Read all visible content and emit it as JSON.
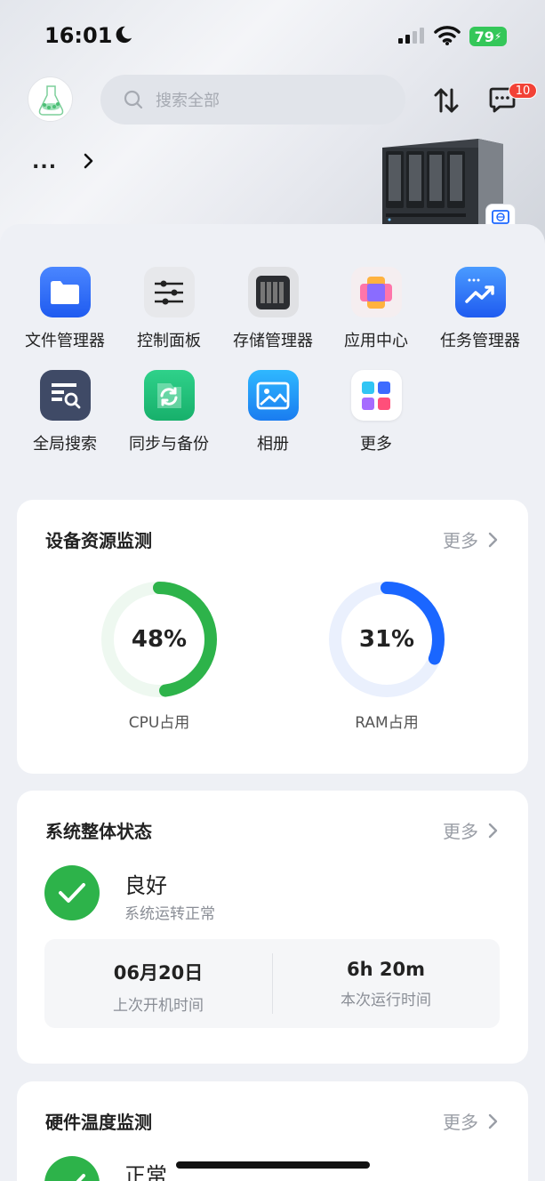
{
  "status_bar": {
    "time": "16:01",
    "battery": "79"
  },
  "header": {
    "search_placeholder": "搜索全部",
    "message_badge": "10",
    "device_name": "..."
  },
  "apps": [
    {
      "label": "文件管理器",
      "icon": "folder-icon"
    },
    {
      "label": "控制面板",
      "icon": "sliders-icon"
    },
    {
      "label": "存储管理器",
      "icon": "storage-icon"
    },
    {
      "label": "应用中心",
      "icon": "app-center-icon"
    },
    {
      "label": "任务管理器",
      "icon": "task-chart-icon"
    },
    {
      "label": "全局搜索",
      "icon": "global-search-icon"
    },
    {
      "label": "同步与备份",
      "icon": "sync-icon"
    },
    {
      "label": "相册",
      "icon": "photo-icon"
    },
    {
      "label": "更多",
      "icon": "more-apps-icon"
    }
  ],
  "resource_card": {
    "title": "设备资源监测",
    "more": "更多",
    "cpu": {
      "value": "48%",
      "fraction": 0.48,
      "label": "CPU占用",
      "color": "#2db34a"
    },
    "ram": {
      "value": "31%",
      "fraction": 0.31,
      "label": "RAM占用",
      "color": "#1a66ff"
    }
  },
  "system_card": {
    "title": "系统整体状态",
    "more": "更多",
    "status": "良好",
    "status_sub": "系统运转正常",
    "last_boot_value": "06月20日",
    "last_boot_label": "上次开机时间",
    "uptime_value": "6h 20m",
    "uptime_label": "本次运行时间"
  },
  "hw_card": {
    "title": "硬件温度监测",
    "more": "更多",
    "status": "正常"
  }
}
